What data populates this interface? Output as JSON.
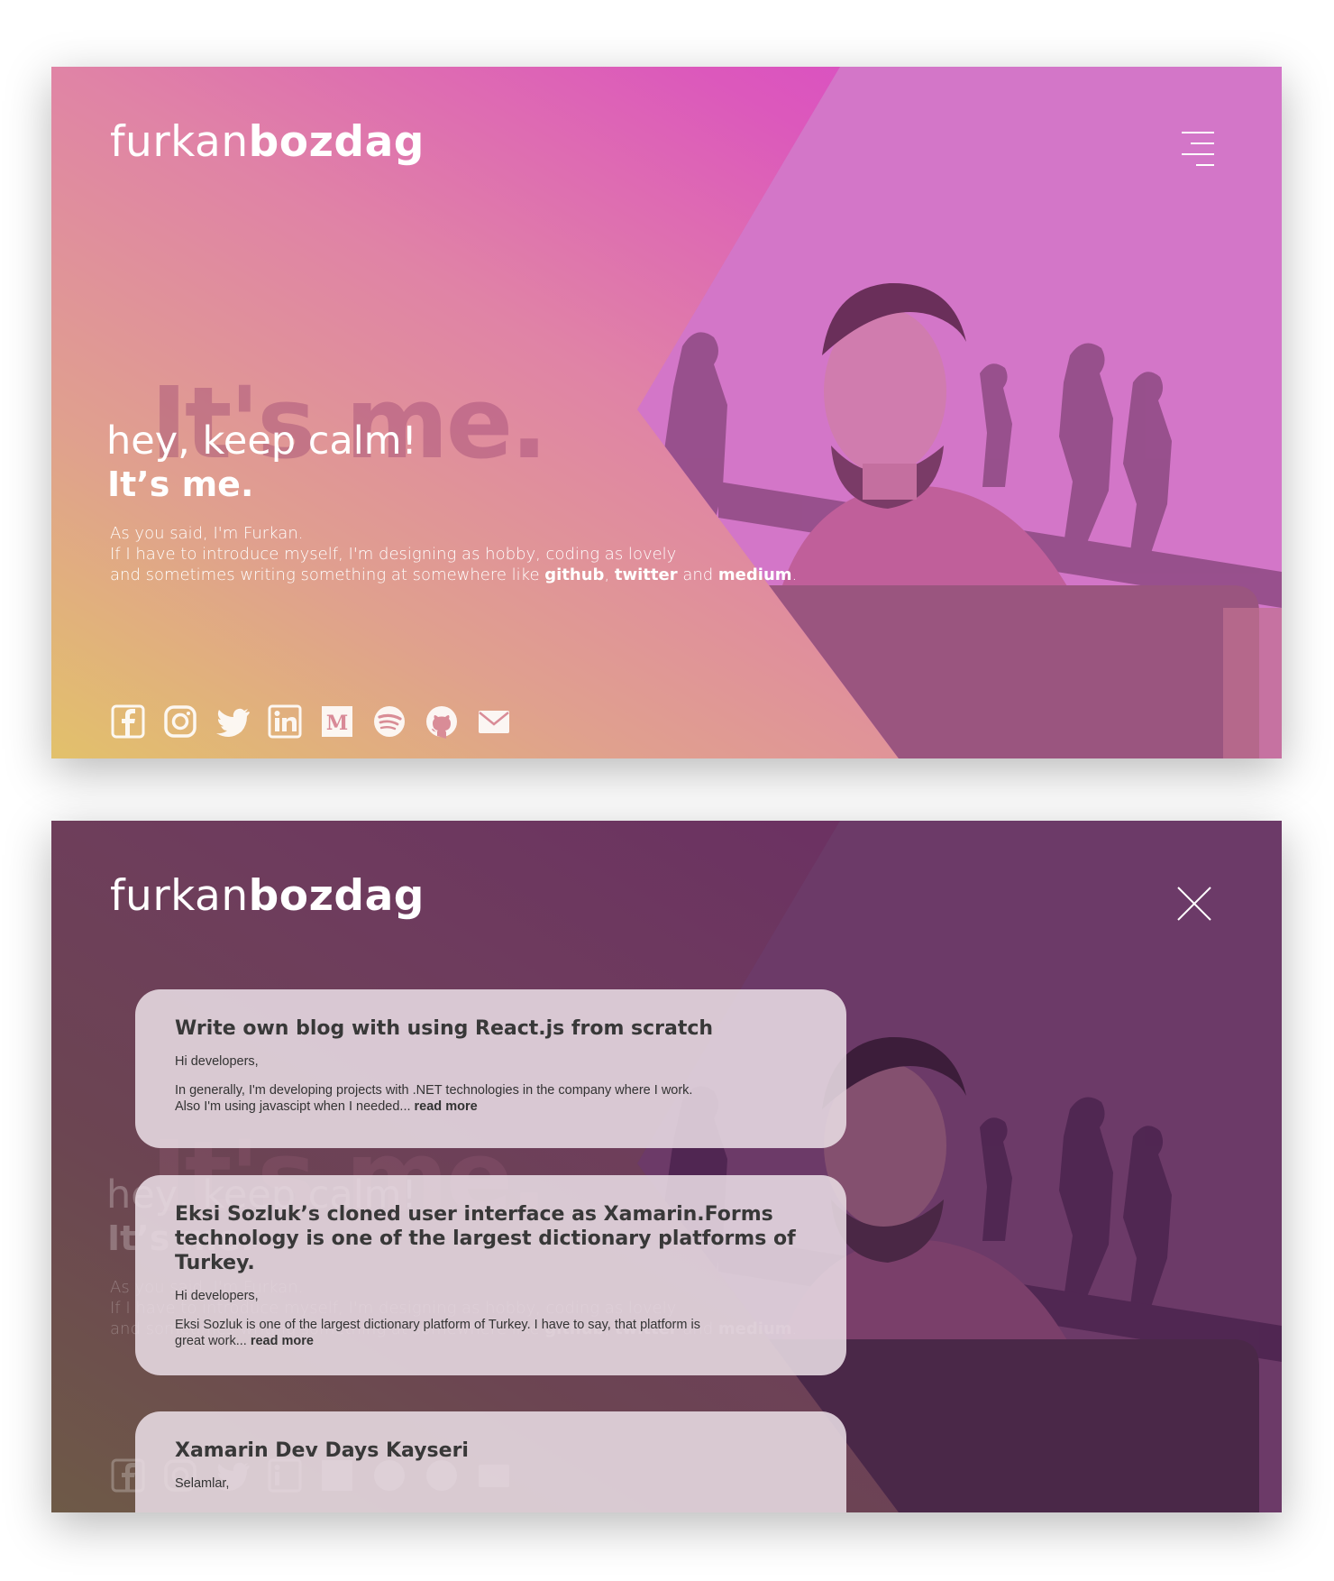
{
  "brand": {
    "light": "furkan",
    "bold": "bozdag"
  },
  "hero": {
    "ghost": "It's me.",
    "greeting": "hey, keep calm!",
    "headline": "It’s me.",
    "intro_line1": "As you said, I'm Furkan.",
    "intro_line2": "If I have to introduce myself, I'm designing as hobby, coding as lovely",
    "intro_line3_a": "and sometimes writing something at somewhere like ",
    "link_github": "github",
    "sep_comma": ", ",
    "link_twitter": "twitter",
    "sep_and": " and ",
    "link_medium": "medium",
    "period": "."
  },
  "socials": [
    "facebook-icon",
    "instagram-icon",
    "twitter-icon",
    "linkedin-icon",
    "medium-icon",
    "spotify-icon",
    "github-icon",
    "mail-icon"
  ],
  "menu": {
    "open_icon": "hamburger-menu-icon",
    "close_icon": "close-icon"
  },
  "posts": [
    {
      "title": "Write own blog with using React.js from scratch",
      "p1": "Hi developers,",
      "p2a": "In generally, I'm developing projects with .NET technologies in the company where I work.",
      "p2b": "Also I'm using javascipt when I needed... ",
      "more": "read more"
    },
    {
      "title": "Eksi Sozluk’s cloned user interface as Xamarin.Forms technology is one of the largest dictionary platforms of Turkey.",
      "p1": "Hi developers,",
      "p2a": "Eksi Sozluk is one of the largest dictionary platform of Turkey. I have to say, that platform is",
      "p2b": "great work... ",
      "more": "read more"
    },
    {
      "title": "Xamarin Dev Days Kayseri",
      "p1": "Selamlar,",
      "p2a": "",
      "p2b": "",
      "more": ""
    }
  ],
  "colors": {
    "top_gradient": [
      "#e2c16b",
      "#e083a6",
      "#d543cd"
    ],
    "bottom_gradient": [
      "#6e5a47",
      "#6e3c5d",
      "#6a2a66"
    ],
    "card_bg": "#e8dce4",
    "text_light": "#ffffff"
  }
}
